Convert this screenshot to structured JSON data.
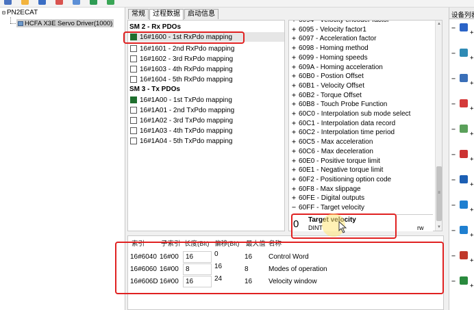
{
  "toolbar": {
    "icons": [
      "new-file-icon",
      "open-icon",
      "save-icon",
      "config-icon",
      "network-icon",
      "device-icon",
      "refresh-icon"
    ],
    "icon_colors": [
      "#4a73c0",
      "#f2b33d",
      "#3b6ec4",
      "#d9534f",
      "#5c8fd6",
      "#2f9c54",
      "#3aa656"
    ]
  },
  "tree": {
    "root_expander": "⊟",
    "root_label": "PN2ECAT",
    "child_label": "HCFA X3E Servo Driver(1000)"
  },
  "tabs": [
    {
      "label": "常规",
      "active": false
    },
    {
      "label": "过程数据",
      "active": true
    },
    {
      "label": "启动信息",
      "active": false
    }
  ],
  "pdo_panel": {
    "rx_header": "SM 2 - Rx PDOs",
    "tx_header": "SM 3 - Tx PDOs",
    "rx": [
      {
        "label": "16#1600  -  1st RxPdo mapping",
        "checked": true
      },
      {
        "label": "16#1601  -  2nd RxPdo mapping",
        "checked": false
      },
      {
        "label": "16#1602  -  3rd RxPdo mapping",
        "checked": false
      },
      {
        "label": "16#1603  -  4th RxPdo mapping",
        "checked": false
      },
      {
        "label": "16#1604  -  5th RxPdo mapping",
        "checked": false
      }
    ],
    "tx": [
      {
        "label": "16#1A00  -  1st TxPdo mapping",
        "checked": true
      },
      {
        "label": "16#1A01  -  2nd TxPdo mapping",
        "checked": false
      },
      {
        "label": "16#1A02  -  3rd TxPdo mapping",
        "checked": false
      },
      {
        "label": "16#1A03  -  4th TxPdo mapping",
        "checked": false
      },
      {
        "label": "16#1A04  -  5th TxPdo mapping",
        "checked": false
      }
    ]
  },
  "od_list": [
    {
      "exp": "+",
      "label": "6094 - Velocity encoder factor"
    },
    {
      "exp": "+",
      "label": "6095 - Velocity factor1"
    },
    {
      "exp": "+",
      "label": "6097 - Acceleration factor"
    },
    {
      "exp": "+",
      "label": "6098 - Homing method"
    },
    {
      "exp": "+",
      "label": "6099 - Homing speeds"
    },
    {
      "exp": "+",
      "label": "609A - Homing acceleration"
    },
    {
      "exp": "+",
      "label": "60B0 - Postion Offset"
    },
    {
      "exp": "+",
      "label": "60B1 - Velocity Offset"
    },
    {
      "exp": "+",
      "label": "60B2 - Torque Offset"
    },
    {
      "exp": "+",
      "label": "60B8 - Touch Probe Function"
    },
    {
      "exp": "+",
      "label": "60C0 - Interpolation sub mode select"
    },
    {
      "exp": "+",
      "label": "60C1 - Interpolation data record"
    },
    {
      "exp": "+",
      "label": "60C2 - Interpolation time period"
    },
    {
      "exp": "+",
      "label": "60C5 - Max acceleration"
    },
    {
      "exp": "+",
      "label": "60C6 - Max deceleration"
    },
    {
      "exp": "+",
      "label": "60E0 - Positive torque limit"
    },
    {
      "exp": "+",
      "label": "60E1 - Negative torque limit"
    },
    {
      "exp": "+",
      "label": "60F2 - Positioning option code"
    },
    {
      "exp": "+",
      "label": "60F8 - Max slippage"
    },
    {
      "exp": "+",
      "label": "60FE - Digital outputs"
    },
    {
      "exp": "−",
      "label": "60FF - Target velocity"
    }
  ],
  "detail": {
    "subindex": "0",
    "name": "Target velocity",
    "type": "DINT",
    "access": "rw"
  },
  "mapping_table": {
    "headers": [
      "索引",
      "子索引",
      "长度(Bit)",
      "偏移(Bit)",
      "最大值",
      "名称"
    ],
    "rows": [
      {
        "index": "16#6040",
        "sub": "16#00",
        "len": "16",
        "offset": "0",
        "max": "16",
        "name": "Control Word"
      },
      {
        "index": "16#6060",
        "sub": "16#00",
        "len": "8",
        "offset": "16",
        "max": "8",
        "name": "Modes of operation"
      },
      {
        "index": "16#606D",
        "sub": "16#00",
        "len": "16",
        "offset": "24",
        "max": "16",
        "name": "Velocity window"
      }
    ]
  },
  "device_list": {
    "header": "设备列表",
    "items": [
      {
        "icon": "device-icon",
        "color": "#2b64c7"
      },
      {
        "icon": "device-icon",
        "color": "#2f8bb5"
      },
      {
        "icon": "device-icon",
        "color": "#3a6fb8"
      },
      {
        "icon": "device-icon",
        "color": "#d43a3a"
      },
      {
        "icon": "device-icon",
        "color": "#5aa05a"
      },
      {
        "icon": "device-icon",
        "color": "#cc3333"
      },
      {
        "icon": "device-icon",
        "color": "#1c5fb4"
      },
      {
        "icon": "device-icon",
        "color": "#1f7fd0"
      },
      {
        "icon": "device-icon",
        "color": "#1f7fd0"
      },
      {
        "icon": "device-icon",
        "color": "#c0392b"
      },
      {
        "icon": "device-icon",
        "color": "#2a8a3e"
      }
    ]
  }
}
